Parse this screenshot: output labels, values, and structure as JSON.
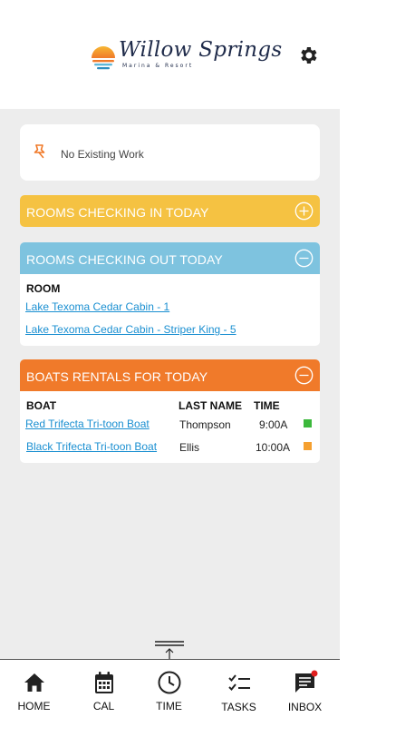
{
  "header": {
    "brand_name": "Willow Springs",
    "brand_tagline": "Marina & Resort",
    "settings_icon": "gear-icon"
  },
  "work": {
    "icon": "pin-icon",
    "text": "No Existing Work"
  },
  "checking_in": {
    "title": "ROOMS CHECKING IN TODAY",
    "toggle_icon": "plus-circle-icon",
    "color": "#f5c242"
  },
  "checking_out": {
    "title": "ROOMS CHECKING OUT TODAY",
    "toggle_icon": "minus-circle-icon",
    "color": "#7ec3df",
    "column_room": "ROOM",
    "rooms": [
      "Lake Texoma Cedar Cabin - 1",
      "Lake Texoma Cedar Cabin - Striper King - 5"
    ]
  },
  "boats": {
    "title": "BOATS RENTALS FOR TODAY",
    "toggle_icon": "minus-circle-icon",
    "color": "#f07a2a",
    "columns": {
      "boat": "BOAT",
      "last_name": "LAST NAME",
      "time": "TIME"
    },
    "rows": [
      {
        "boat": "Red Trifecta Tri-toon Boat",
        "last_name": "Thompson",
        "time": "9:00A",
        "status_color": "#3cb83c"
      },
      {
        "boat": "Black Trifecta Tri-toon Boat",
        "last_name": "Ellis",
        "time": "10:00A",
        "status_color": "#f5a030"
      }
    ]
  },
  "tabbar": {
    "home": "HOME",
    "cal": "CAL",
    "time": "TIME",
    "tasks": "TASKS",
    "inbox": "INBOX",
    "inbox_badge_color": "#e01e1e"
  }
}
